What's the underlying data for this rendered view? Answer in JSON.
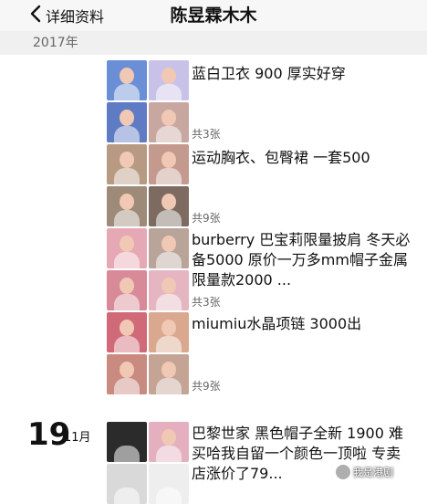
{
  "nav": {
    "back_label": "详细资料",
    "title": "陈昱霖木木"
  },
  "year": "2017年",
  "posts": [
    {
      "caption": "蓝白卫衣 900 厚实好穿",
      "count": "共3张",
      "thumb_colors": [
        "#6a8fd6",
        "#c9c2e8",
        "#5f7bc4",
        "#c8a7a0"
      ]
    },
    {
      "caption": "运动胸衣、包臀裙 一套500",
      "count": "共9张",
      "thumb_colors": [
        "#b89a82",
        "#c59a8e",
        "#9e8a78",
        "#7d6a60"
      ]
    },
    {
      "caption": "burberry 巴宝莉限量披肩 冬天必备5000 原价一万多mm帽子金属限量款2000 ...",
      "count": "共3张",
      "thumb_colors": [
        "#e6a8b4",
        "#b9a49a",
        "#d88a98",
        "#e5b6c2"
      ]
    },
    {
      "caption": "miumiu水晶项链 3000出",
      "count": "共9张",
      "thumb_colors": [
        "#d06a78",
        "#d9a88e",
        "#c98a80",
        "#c4a595"
      ]
    }
  ],
  "date": {
    "day": "19",
    "month": "11月"
  },
  "last_post": {
    "caption": "巴黎世家 黑色帽子全新 1900 难买哈我自留一个颜色一顶啦 专卖店涨价了79...",
    "thumb_colors": [
      "#2b2b2b",
      "#e4b0c0",
      "#d9d9d9",
      "#eeeeee"
    ]
  },
  "watermark": "我是港剧"
}
